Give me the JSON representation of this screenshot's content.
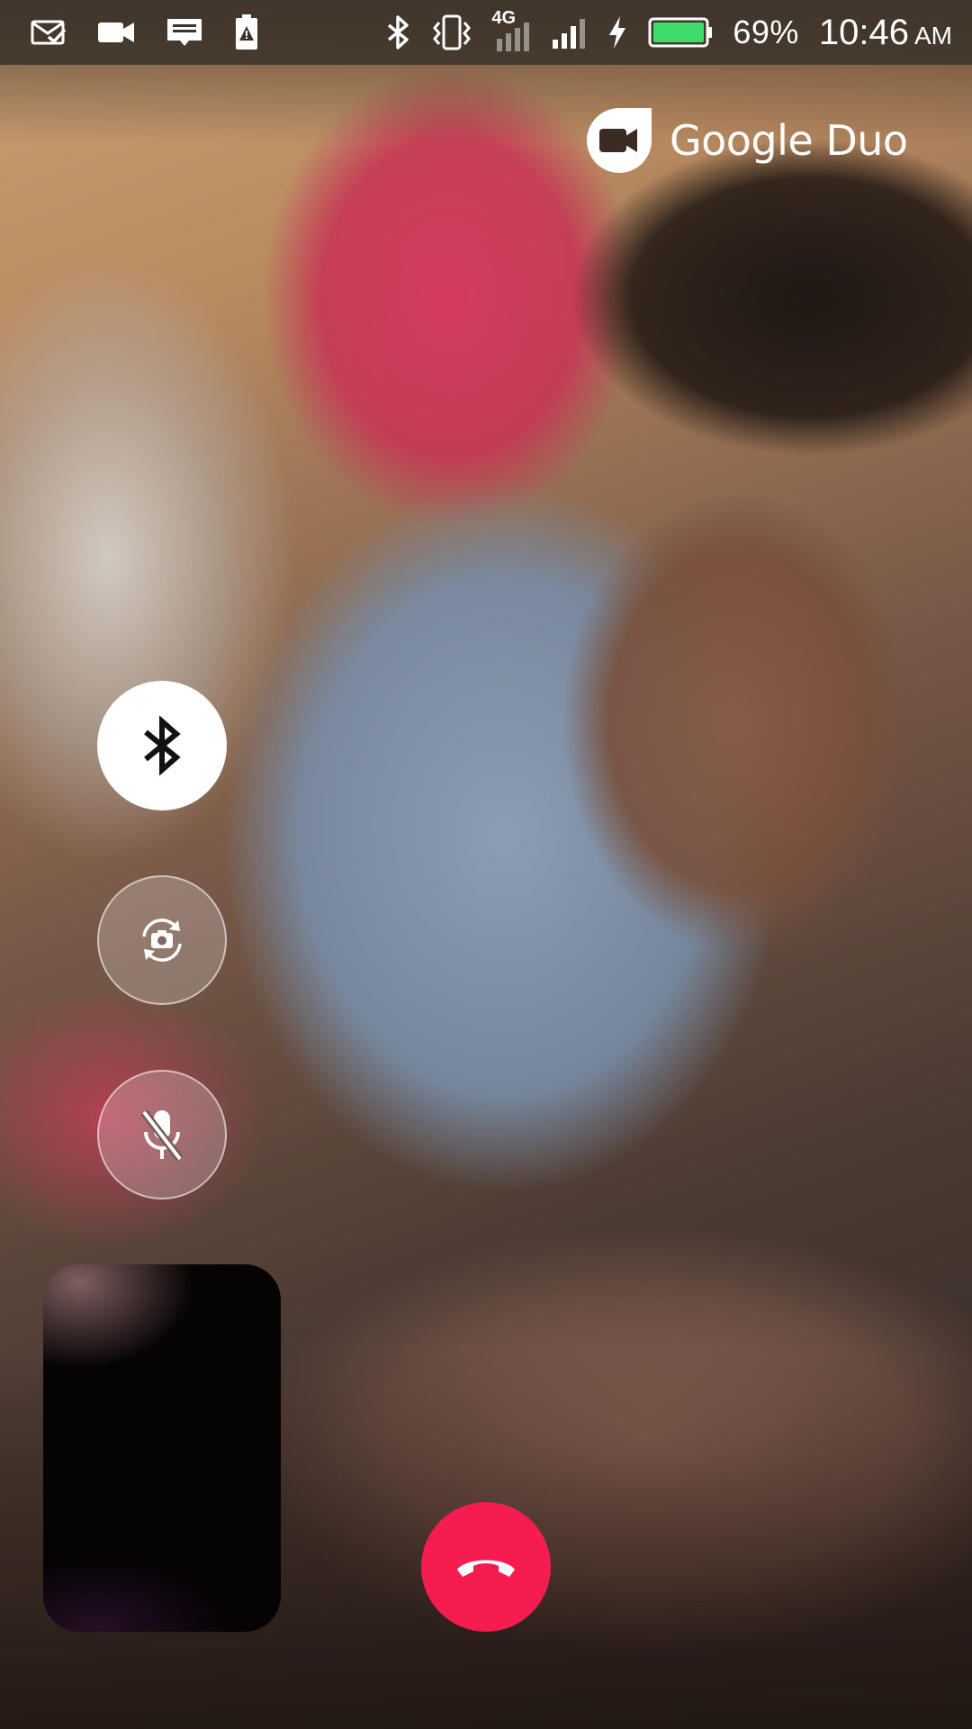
{
  "status_bar": {
    "left_icons": [
      "mail-check-icon",
      "video-camera-icon",
      "message-icon",
      "battery-alert-icon"
    ],
    "right_icons": [
      "bluetooth-icon",
      "vibrate-icon",
      "signal-4g-icon",
      "signal-bars-icon",
      "charging-icon",
      "battery-icon"
    ],
    "network_label": "4G",
    "battery_percent": "69%",
    "battery_level": 0.69,
    "battery_color": "#3ddc6c",
    "time": "10:46",
    "ampm": "AM"
  },
  "brand": {
    "name": "Google Duo",
    "logo_icon": "duo-camera-icon"
  },
  "controls": {
    "bluetooth": {
      "icon": "bluetooth-icon",
      "active": true
    },
    "flip_camera": {
      "icon": "flip-camera-icon",
      "active": false
    },
    "mute": {
      "icon": "mic-off-icon",
      "active": false
    }
  },
  "end_call": {
    "icon": "phone-hangup-icon",
    "color": "#f51d4f"
  }
}
